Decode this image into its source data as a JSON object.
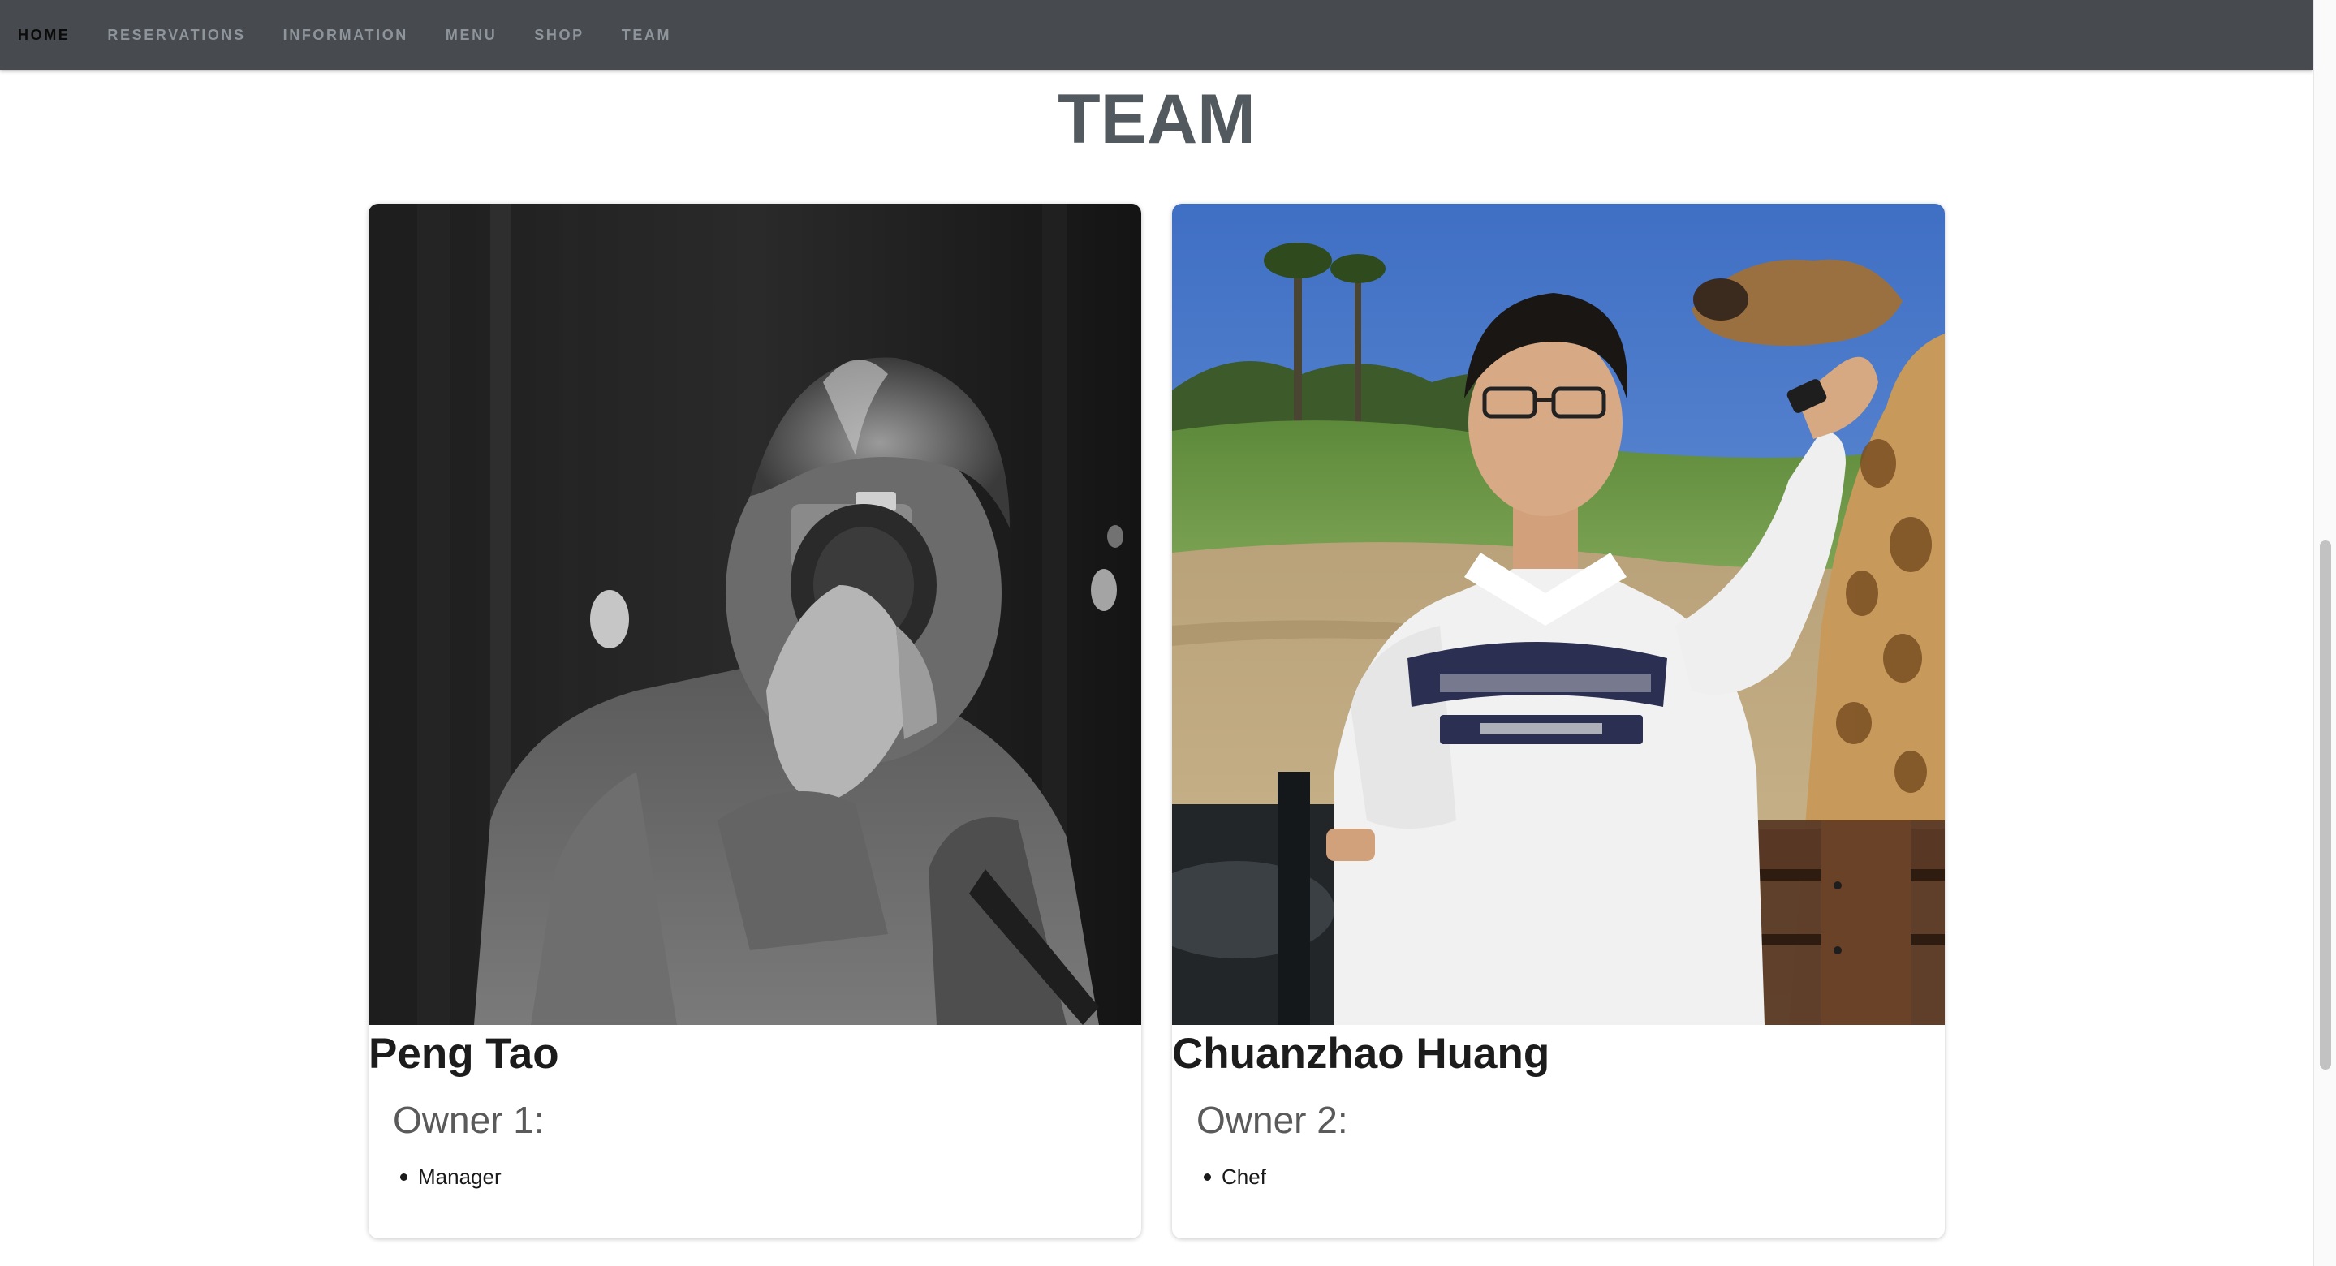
{
  "nav": {
    "items": [
      "HOME",
      "RESERVATIONS",
      "INFORMATION",
      "MENU",
      "SHOP",
      "TEAM"
    ],
    "active": "HOME"
  },
  "page": {
    "title": "TEAM"
  },
  "team": [
    {
      "name": "Peng Tao",
      "role": "Owner 1:",
      "duties": [
        "Manager"
      ]
    },
    {
      "name": "Chuanzhao Huang",
      "role": "Owner 2:",
      "duties": [
        "Chef"
      ]
    }
  ],
  "colors": {
    "navbar": "#474a4e",
    "nav_text": "#8d949b",
    "nav_active": "#0b0b0b",
    "title": "#52595f",
    "card_bg": "#ffffff"
  },
  "icons": {
    "bullet": "bullet-dot-icon"
  }
}
